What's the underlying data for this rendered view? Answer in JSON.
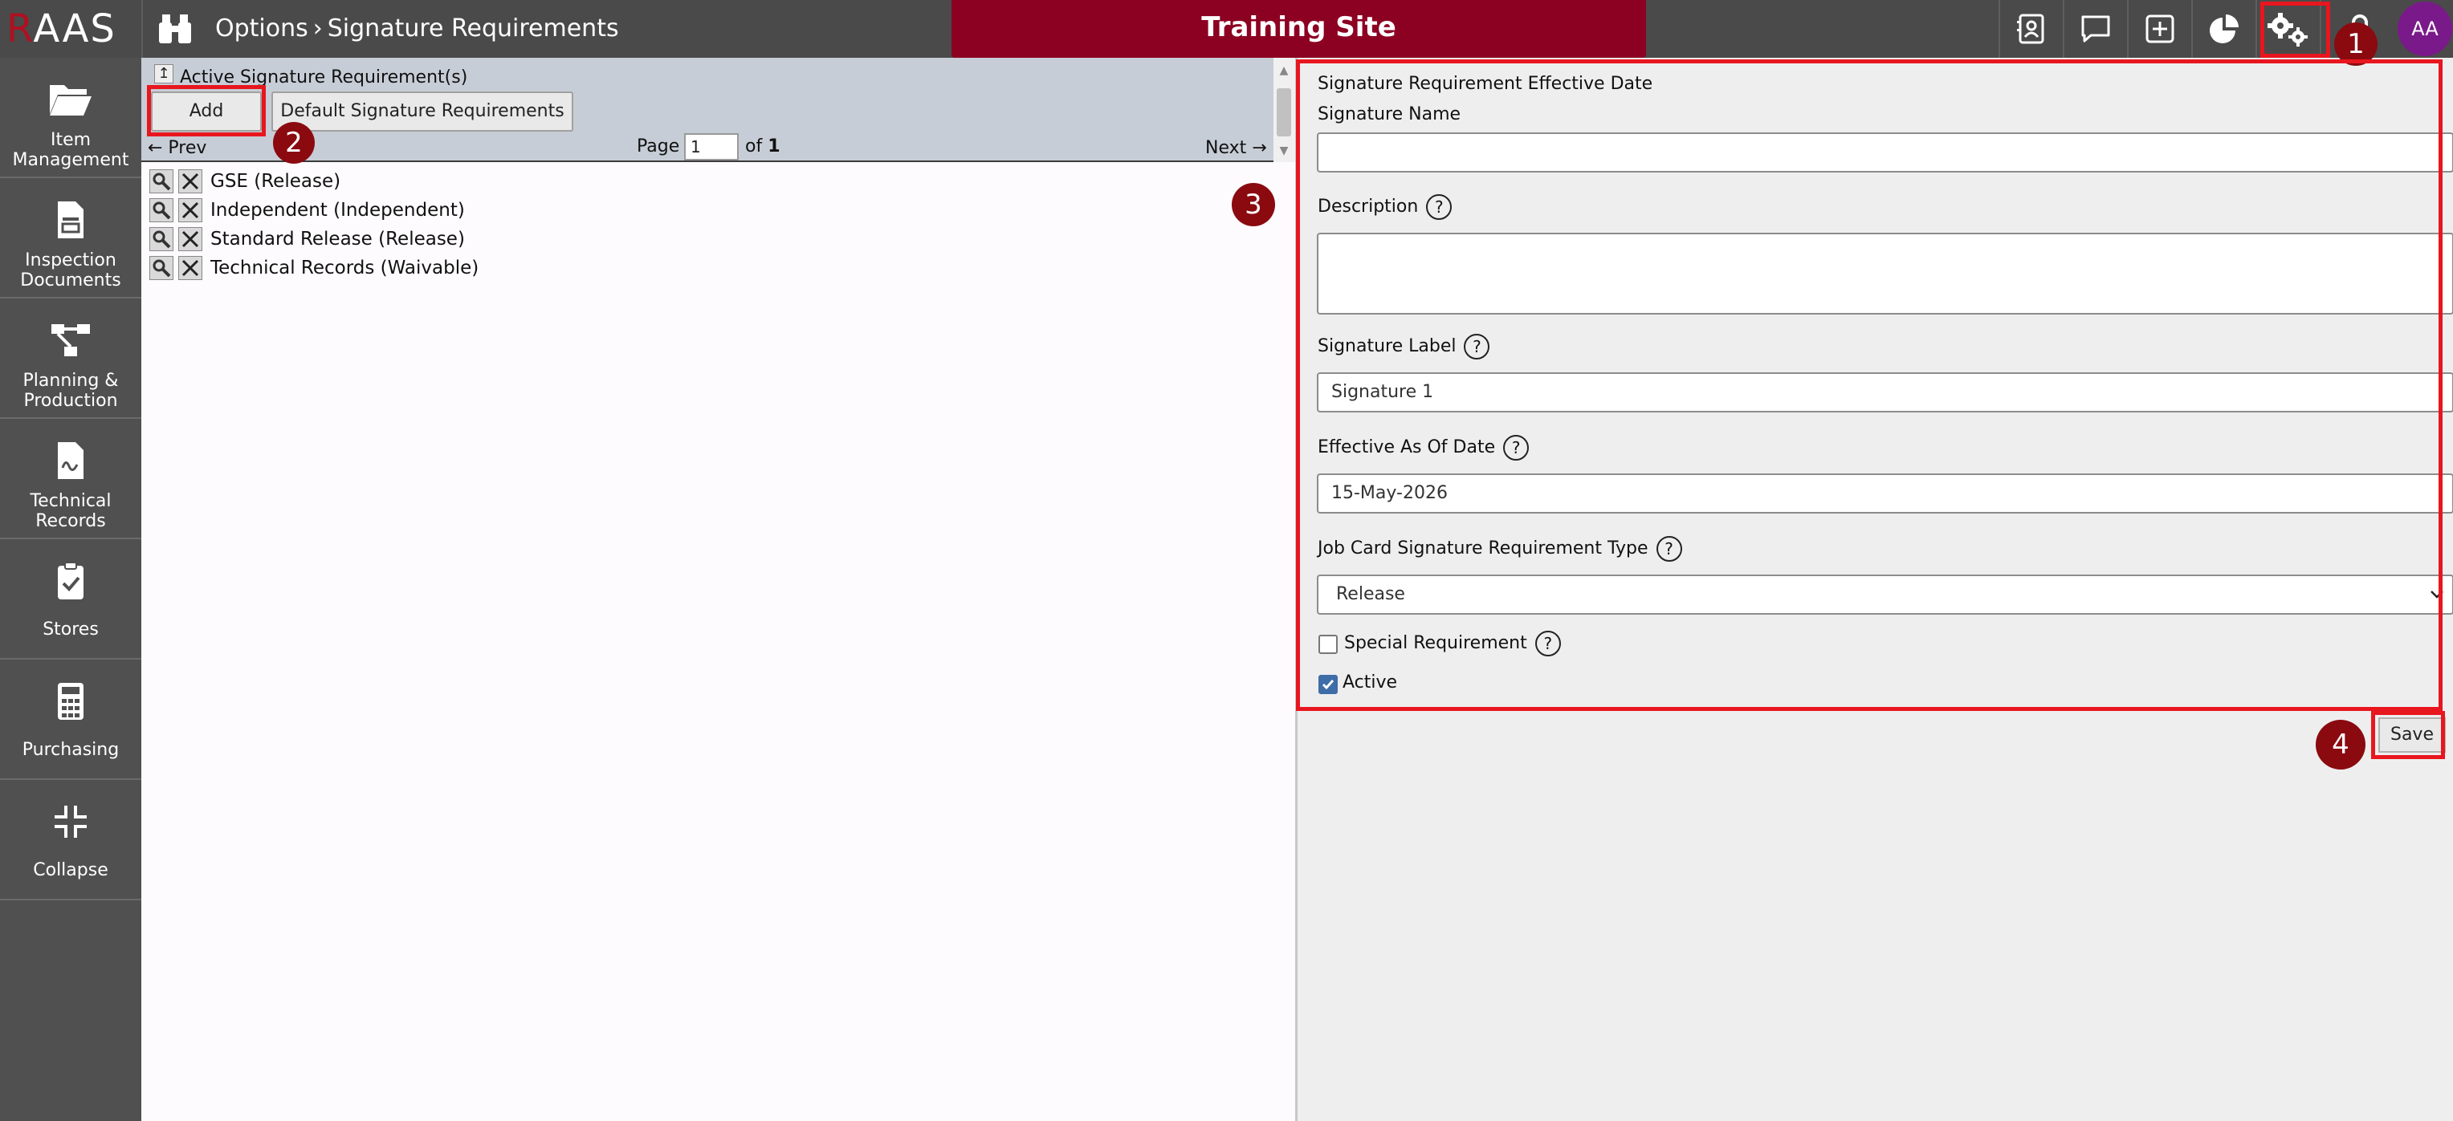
{
  "header": {
    "logo_r": "R",
    "logo_rest": "AAS",
    "breadcrumb_root": "Options",
    "breadcrumb_sep": "›",
    "breadcrumb_page": "Signature Requirements",
    "site_banner": "Training Site",
    "avatar_initials": "AA"
  },
  "sidebar": {
    "items": [
      {
        "label_1": "Item",
        "label_2": "Management"
      },
      {
        "label_1": "Inspection",
        "label_2": "Documents"
      },
      {
        "label_1": "Planning &",
        "label_2": "Production"
      },
      {
        "label_1": "Technical",
        "label_2": "Records"
      },
      {
        "label_1": "Stores",
        "label_2": ""
      },
      {
        "label_1": "Purchasing",
        "label_2": ""
      },
      {
        "label_1": "Collapse",
        "label_2": ""
      }
    ]
  },
  "list_panel": {
    "title": "Active Signature Requirement(s)",
    "add_label": "Add",
    "default_label": "Default Signature Requirements",
    "prev_label": "← Prev",
    "next_label": "Next →",
    "page_label": "Page",
    "page_value": "1",
    "of_label": "of",
    "page_total": "1",
    "items": [
      "GSE (Release)",
      "Independent (Independent)",
      "Standard Release (Release)",
      "Technical Records (Waivable)"
    ]
  },
  "form": {
    "section_title": "Signature Requirement Effective Date",
    "name_label": "Signature Name",
    "name_value": "",
    "description_label": "Description",
    "description_value": "",
    "sig_label_label": "Signature Label",
    "sig_label_value": "Signature 1",
    "effective_label": "Effective As Of Date",
    "effective_value": "15-May-2026",
    "type_label": "Job Card Signature Requirement Type",
    "type_value": "Release",
    "special_label": "Special Requirement",
    "special_checked": false,
    "active_label": "Active",
    "active_checked": true,
    "help_glyph": "?",
    "save_label": "Save"
  },
  "annotations": {
    "badges": [
      "1",
      "2",
      "3",
      "4"
    ],
    "badge_color": "#8a0a10",
    "box_color": "#e8161e"
  },
  "colors": {
    "topbar": "#4a4a4a",
    "banner": "#8c0022",
    "sidebar": "#505050",
    "avatar": "#7a1a8a"
  }
}
